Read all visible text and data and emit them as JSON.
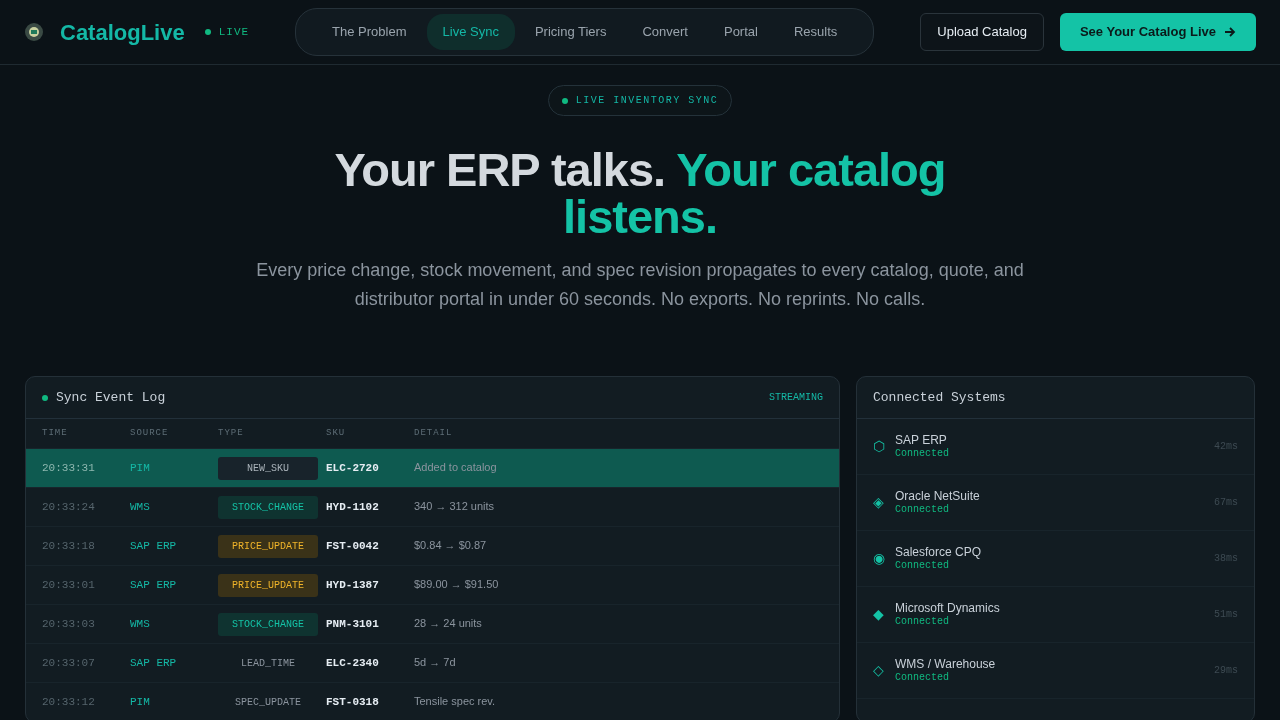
{
  "brand": {
    "name": "CatalogLive",
    "status": "LIVE"
  },
  "nav": [
    {
      "label": "The Problem",
      "selected": false
    },
    {
      "label": "Live Sync",
      "selected": true
    },
    {
      "label": "Pricing Tiers",
      "selected": false
    },
    {
      "label": "Convert",
      "selected": false
    },
    {
      "label": "Portal",
      "selected": false
    },
    {
      "label": "Results",
      "selected": false
    }
  ],
  "actions": {
    "secondary": "Upload Catalog",
    "primary": "See Your Catalog Live"
  },
  "hero": {
    "badge": "LIVE INVENTORY SYNC",
    "headline": [
      {
        "text": "Your ERP talks.",
        "accent": false
      },
      {
        "text": "Your catalog listens.",
        "accent": true
      }
    ],
    "subtitle": "Every price change, stock movement, and spec revision propagates to every catalog, quote, and distributor portal in under 60 seconds. No exports. No reprints. No calls."
  },
  "log": {
    "title": "Sync Event Log",
    "status": "STREAMING",
    "columns": [
      "TIME",
      "SOURCE",
      "TYPE",
      "SKU",
      "DETAIL"
    ],
    "rows": [
      {
        "time": "20:33:31",
        "source": "PIM",
        "type": "NEW_SKU",
        "kind": "new",
        "sku": "ELC-2720",
        "detail": "Added to catalog",
        "selected": true
      },
      {
        "time": "20:33:24",
        "source": "WMS",
        "type": "STOCK_CHANGE",
        "kind": "stock",
        "sku": "HYD-1102",
        "detail": "340 → 312 units",
        "selected": false
      },
      {
        "time": "20:33:18",
        "source": "SAP ERP",
        "type": "PRICE_UPDATE",
        "kind": "price",
        "sku": "FST-0042",
        "detail": "$0.84 → $0.87",
        "selected": false
      },
      {
        "time": "20:33:01",
        "source": "SAP ERP",
        "type": "PRICE_UPDATE",
        "kind": "price",
        "sku": "HYD-1387",
        "detail": "$89.00 → $91.50",
        "selected": false
      },
      {
        "time": "20:33:03",
        "source": "WMS",
        "type": "STOCK_CHANGE",
        "kind": "stock",
        "sku": "PNM-3101",
        "detail": "28 → 24 units",
        "selected": false
      },
      {
        "time": "20:33:07",
        "source": "SAP ERP",
        "type": "LEAD_TIME",
        "kind": "plain",
        "sku": "ELC-2340",
        "detail": "5d → 7d",
        "selected": false
      },
      {
        "time": "20:33:12",
        "source": "PIM",
        "type": "SPEC_UPDATE",
        "kind": "plain",
        "sku": "FST-0318",
        "detail": "Tensile spec rev.",
        "selected": false
      }
    ]
  },
  "systems": {
    "title": "Connected Systems",
    "items": [
      {
        "icon": "⬡",
        "name": "SAP ERP",
        "status": "Connected",
        "latency": "42ms"
      },
      {
        "icon": "◈",
        "name": "Oracle NetSuite",
        "status": "Connected",
        "latency": "67ms"
      },
      {
        "icon": "◉",
        "name": "Salesforce CPQ",
        "status": "Connected",
        "latency": "38ms"
      },
      {
        "icon": "◆",
        "name": "Microsoft Dynamics",
        "status": "Connected",
        "latency": "51ms"
      },
      {
        "icon": "◇",
        "name": "WMS / Warehouse",
        "status": "Connected",
        "latency": "29ms"
      }
    ]
  }
}
